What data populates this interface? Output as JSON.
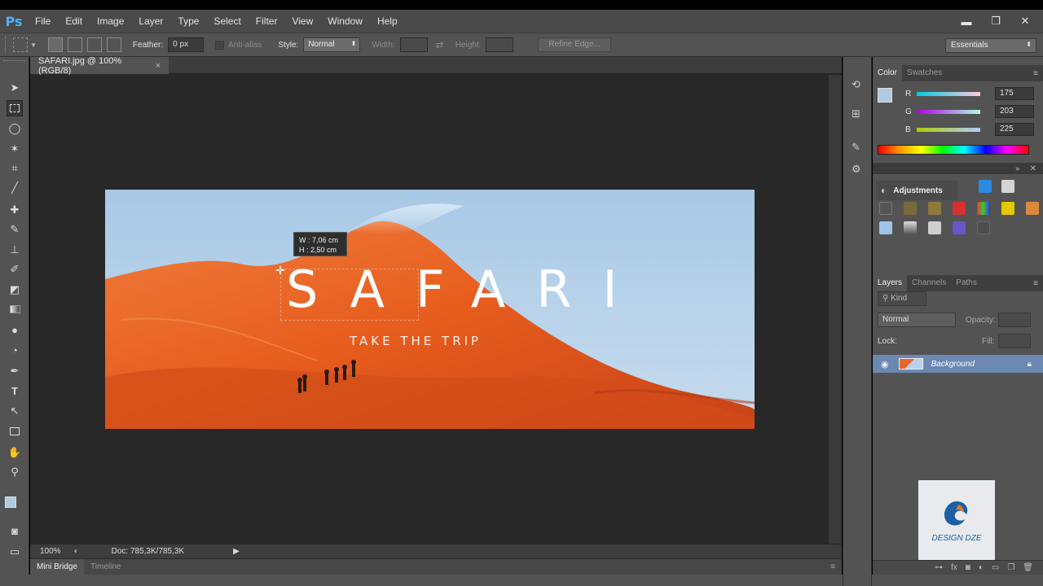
{
  "app": {
    "logo": "Ps",
    "menu": [
      "File",
      "Edit",
      "Image",
      "Layer",
      "Type",
      "Select",
      "Filter",
      "View",
      "Window",
      "Help"
    ],
    "window_controls": {
      "minimize": "▬",
      "restore": "❐",
      "close": "✕"
    }
  },
  "options_bar": {
    "feather_label": "Feather:",
    "feather_value": "0 px",
    "antialias_label": "Anti-alias",
    "style_label": "Style:",
    "style_value": "Normal",
    "width_label": "Width:",
    "height_label": "Height:",
    "refine_edge": "Refine Edge...",
    "workspace": "Essentials"
  },
  "document": {
    "tab_title": "SAFARI.jpg @ 100% (RGB/8)",
    "tab_close": "×",
    "zoom": "100%",
    "doc_size": "Doc: 785,3K/785,3K",
    "bottom_tabs": [
      "Mini Bridge",
      "Timeline"
    ]
  },
  "artwork": {
    "title": "SAFARI",
    "subtitle": "TAKE THE TRIP"
  },
  "tooltip": {
    "w_line": "W :  7,06 cm",
    "h_line": "H :  2,50 cm"
  },
  "color_panel": {
    "tabs": [
      "Color",
      "Swatches"
    ],
    "r_label": "R",
    "r_value": "175",
    "g_label": "G",
    "g_value": "203",
    "b_label": "B",
    "b_value": "225",
    "foreground": "#afcbe1"
  },
  "adjustments_panel": {
    "title": "Adjustments"
  },
  "layers_panel": {
    "tabs": [
      "Layers",
      "Channels",
      "Paths"
    ],
    "filter_kind": "Kind",
    "blend_mode": "Normal",
    "opacity_label": "Opacity:",
    "lock_label": "Lock:",
    "fill_label": "Fill:",
    "layer_name": "Background"
  },
  "watermark": {
    "text": "DESIGN DZE"
  }
}
